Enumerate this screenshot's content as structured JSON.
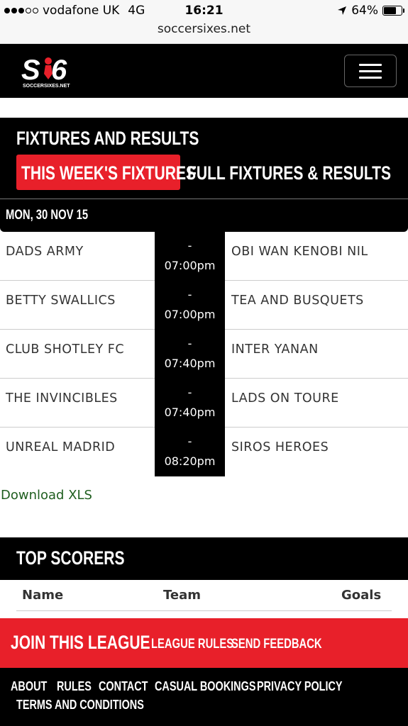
{
  "status_bar": {
    "carrier": "vodafone UK",
    "network": "4G",
    "time": "16:21",
    "battery": "64%"
  },
  "url": "soccersixes.net",
  "header": {
    "logo_text": "S6",
    "logo_sub": "SOCCERSIXES.NET"
  },
  "fixtures": {
    "title": "FIXTURES AND RESULTS",
    "tab_this_week": "THIS WEEK'S FIXTURES",
    "tab_full": "FULL FIXTURES & RESULTS",
    "date": "MON, 30 NOV 15",
    "matches": [
      {
        "home": "DADS ARMY",
        "score": "-",
        "time": "07:00pm",
        "away": "OBI WAN KENOBI NIL"
      },
      {
        "home": "BETTY SWALLICS",
        "score": "-",
        "time": "07:00pm",
        "away": "TEA AND BUSQUETS"
      },
      {
        "home": "CLUB SHOTLEY FC",
        "score": "-",
        "time": "07:40pm",
        "away": "INTER YANAN"
      },
      {
        "home": "THE INVINCIBLES",
        "score": "-",
        "time": "07:40pm",
        "away": "LADS ON TOURE"
      },
      {
        "home": "UNREAL MADRID",
        "score": "-",
        "time": "08:20pm",
        "away": "SIROS HEROES"
      }
    ],
    "download": "Download XLS"
  },
  "top_scorers": {
    "title": "TOP SCORERS",
    "col_name": "Name",
    "col_team": "Team",
    "col_goals": "Goals"
  },
  "join": {
    "label": "JOIN THIS LEAGUE",
    "rules": "LEAGUE RULES",
    "feedback": "SEND FEEDBACK"
  },
  "footer": {
    "links": [
      "ABOUT",
      "RULES",
      "CONTACT",
      "CASUAL BOOKINGS",
      "PRIVACY POLICY",
      "TERMS AND CONDITIONS"
    ]
  },
  "colors": {
    "accent_red": "#e8202a",
    "black": "#000000",
    "link_green": "#1f5e1f"
  }
}
